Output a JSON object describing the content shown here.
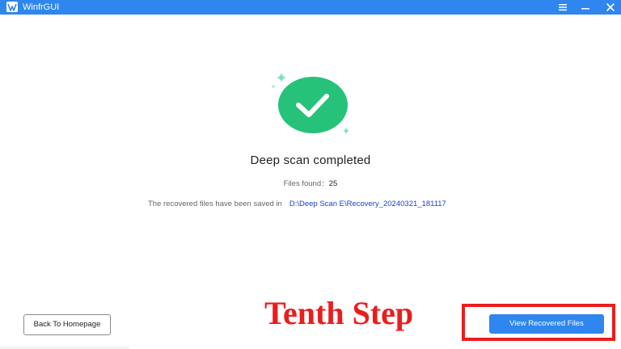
{
  "window": {
    "title": "WinfrGUI",
    "accent_color": "#2f86ee",
    "icons": [
      "app-logo-icon",
      "menu-icon",
      "minimize-icon",
      "close-icon"
    ]
  },
  "status": {
    "title": "Deep scan completed",
    "files_found_label": "Files found",
    "files_found_sep": ":",
    "files_found_count": "25",
    "saved_label": "The recovered files have been saved in",
    "saved_path": "D:\\Deep Scan E\\Recovery_20240321_181117",
    "success_color": "#26c27a",
    "icon": "check-icon"
  },
  "footer": {
    "back_label": "Back To Homepage",
    "view_label": "View Recovered Files"
  },
  "overlay": {
    "step_text": "Tenth Step",
    "highlight_color": "#ea1d1d"
  }
}
